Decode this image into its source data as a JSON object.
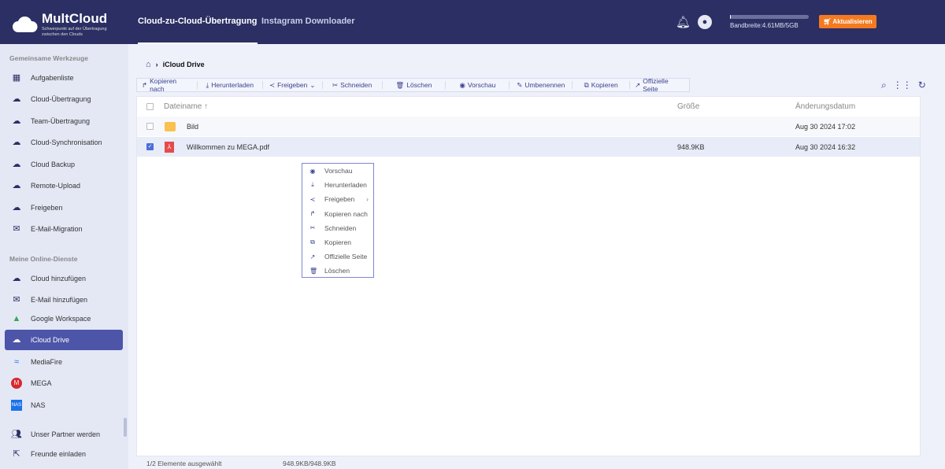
{
  "header": {
    "logo": "MultCloud",
    "tagline": "Schwerpunkt auf der Übertragung zwischen den Clouds",
    "nav": [
      "Cloud-zu-Cloud-Übertragung",
      "Instagram Downloader"
    ],
    "bandwidth": "Bandbreite:4.61MB/5GB",
    "bandwidth_used_fraction": 0.001,
    "upgrade": "Aktualisieren"
  },
  "sidebar": {
    "section1": "Gemeinsame Werkzeuge",
    "tools": [
      "Aufgabenliste",
      "Cloud-Übertragung",
      "Team-Übertragung",
      "Cloud-Synchronisation",
      "Cloud Backup",
      "Remote-Upload",
      "Freigeben",
      "E-Mail-Migration"
    ],
    "section2": "Meine Online-Dienste",
    "services": [
      "Cloud hinzufügen",
      "E-Mail hinzufügen",
      "Google Workspace",
      "iCloud Drive",
      "MediaFire",
      "MEGA",
      "NAS"
    ],
    "bottom": [
      "Unser Partner werden",
      "Freunde einladen"
    ]
  },
  "breadcrumb": {
    "current": "iCloud Drive"
  },
  "toolbar": [
    "Kopieren nach",
    "Herunterladen",
    "Freigeben",
    "Schneiden",
    "Löschen",
    "Vorschau",
    "Umbenennen",
    "Kopieren",
    "Offizielle Seite"
  ],
  "table": {
    "headers": {
      "name": "Dateiname ↑",
      "size": "Größe",
      "date": "Änderungsdatum"
    },
    "rows": [
      {
        "name": "Bild",
        "size": "",
        "date": "Aug 30 2024 17:02",
        "type": "folder",
        "checked": false
      },
      {
        "name": "Willkommen zu MEGA.pdf",
        "size": "948.9KB",
        "date": "Aug 30 2024 16:32",
        "type": "pdf",
        "checked": true
      }
    ]
  },
  "context_menu": [
    "Vorschau",
    "Herunterladen",
    "Freigeben",
    "Kopieren nach",
    "Schneiden",
    "Kopieren",
    "Offizielle Seite",
    "Löschen"
  ],
  "status": {
    "selected": "1/2 Elemente ausgewählt",
    "size": "948.9KB/948.9KB"
  }
}
